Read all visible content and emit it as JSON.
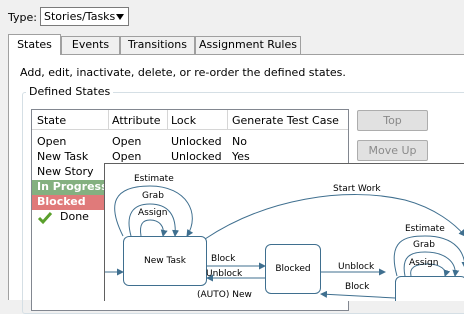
{
  "type_row": {
    "label": "Type:",
    "selected": "Stories/Tasks"
  },
  "tabs": [
    "States",
    "Events",
    "Transitions",
    "Assignment Rules"
  ],
  "description": "Add, edit, inactivate, delete, or re-order the defined states.",
  "group_title": "Defined States",
  "table": {
    "headers": [
      "State",
      "Attribute",
      "Lock",
      "Generate Test Case"
    ],
    "rows": [
      [
        "Open",
        "Open",
        "Unlocked",
        "No"
      ],
      [
        "New Task",
        "Open",
        "Unlocked",
        "Yes"
      ],
      [
        "New Story",
        "",
        "",
        ""
      ],
      [
        "In Progress",
        "",
        "",
        ""
      ],
      [
        "Blocked",
        "",
        "",
        ""
      ],
      [
        "Done",
        "",
        "",
        ""
      ]
    ]
  },
  "buttons": {
    "top": "Top",
    "move_up": "Move Up"
  },
  "diagram": {
    "nodes": {
      "new_task": "New Task",
      "blocked": "Blocked"
    },
    "edges": {
      "estimate_left": "Estimate",
      "grab_left": "Grab",
      "assign_left": "Assign",
      "start_work": "Start Work",
      "block1": "Block",
      "unblock1": "Unblock",
      "unblock2": "Unblock",
      "block2": "Block",
      "auto_new": "(AUTO) New",
      "estimate_right": "Estimate",
      "grab_right": "Grab",
      "assign_right": "Assign"
    }
  },
  "colors": {
    "in_progress": "#84b080",
    "blocked": "#e07a7a",
    "done_check": "#5aa02c"
  }
}
